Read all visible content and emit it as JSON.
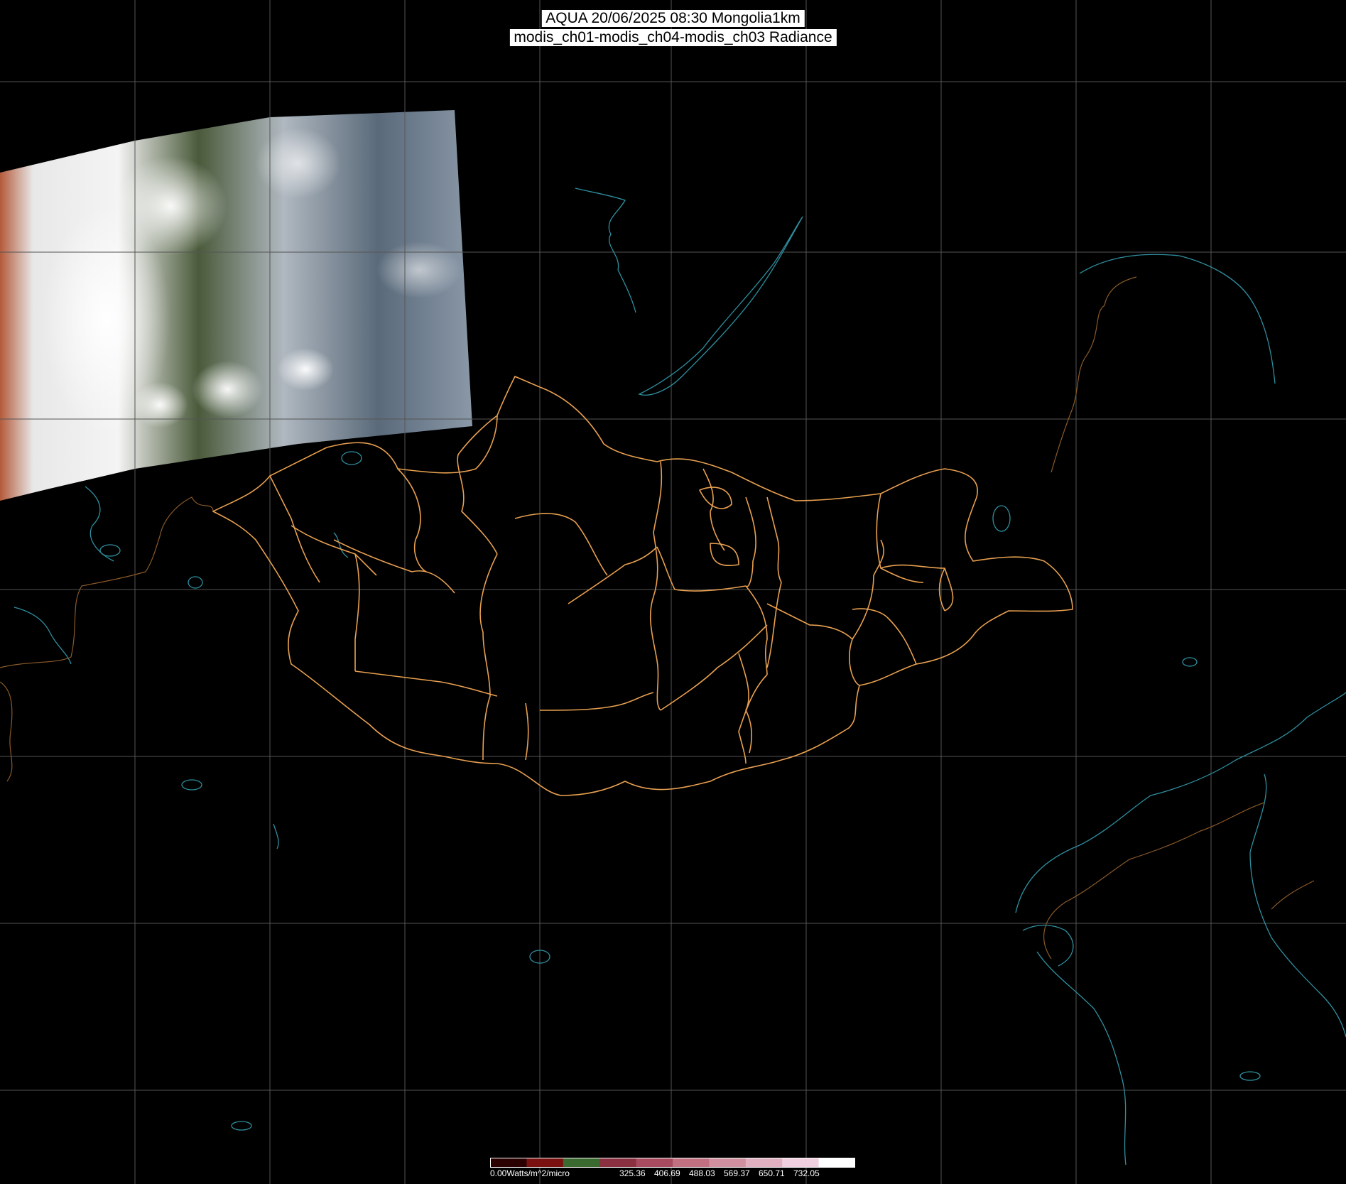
{
  "header": {
    "line1": "AQUA 20/06/2025 08:30 Mongolia1km",
    "line2": "modis_ch01-modis_ch04-modis_ch03 Radiance"
  },
  "colors": {
    "background": "#000000",
    "grid": "#555555",
    "admin_borders": "#e8a050",
    "coastline": "#2f8fa0",
    "country_border": "#8a5a2a"
  },
  "legend": {
    "unit_label": "0.00Watts/m^2/micro",
    "ticks": [
      "325.36",
      "406.69",
      "488.03",
      "569.37",
      "650.71",
      "732.05"
    ],
    "gradient": [
      "#2a0000",
      "#7a1010",
      "#3a6a30",
      "#8a3040",
      "#a84a60",
      "#c07080",
      "#d090a0",
      "#e0b0c0",
      "#f0d0e0",
      "#ffffff"
    ]
  }
}
